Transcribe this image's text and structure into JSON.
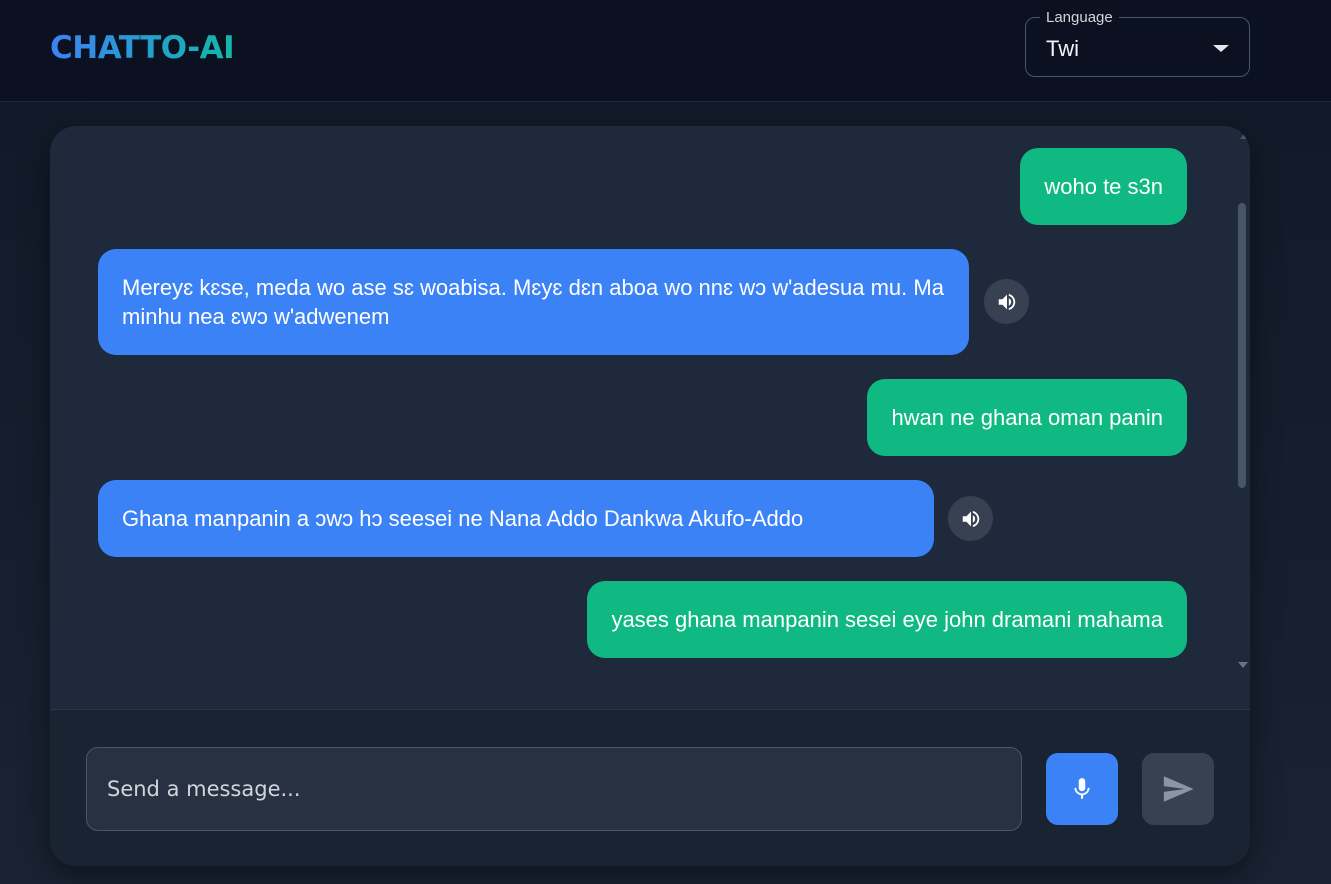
{
  "app": {
    "title": "CHATTO-AI",
    "brand_gradient": [
      "#3b82f6",
      "#14b8a6"
    ]
  },
  "language": {
    "label": "Language",
    "selected": "Twi"
  },
  "messages": [
    {
      "role": "user",
      "text": "woho te s3n"
    },
    {
      "role": "assistant",
      "text": "Mereyɛ kɛse, meda wo ase sɛ woabisa. Mɛyɛ dɛn aboa wo nnɛ wɔ w'adesua mu. Ma minhu nea ɛwɔ w'adwenem"
    },
    {
      "role": "user",
      "text": "hwan ne ghana oman panin"
    },
    {
      "role": "assistant",
      "text": "Ghana manpanin a ɔwɔ hɔ seesei ne Nana Addo Dankwa Akufo-Addo"
    },
    {
      "role": "user",
      "text": "yases ghana manpanin sesei eye john dramani mahama"
    }
  ],
  "composer": {
    "placeholder": "Send a message...",
    "mic_icon": "microphone-icon",
    "send_icon": "send-icon"
  },
  "colors": {
    "user_bubble": "#10b981",
    "assistant_bubble": "#3b82f6",
    "mic_button": "#3b82f6",
    "send_button_disabled": "#374151"
  }
}
